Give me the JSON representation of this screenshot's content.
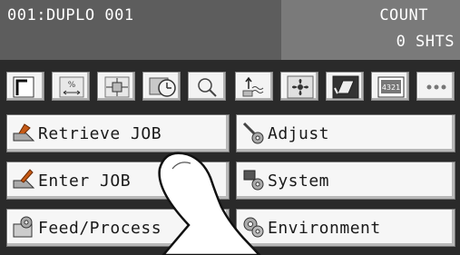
{
  "header": {
    "job_name": "001:DUPLO 001",
    "count_label": "COUNT",
    "count_value": "0 SHTS"
  },
  "toolbar": {
    "icons": [
      "paper-corner-icon",
      "percent-scale-icon",
      "position-adjust-icon",
      "timer-icon",
      "search-icon",
      "feed-wave-icon",
      "fan-icon",
      "fold-icon",
      "counter-icon",
      "more-icon"
    ],
    "counter_text": "4321",
    "more_text": "•••"
  },
  "menu": {
    "retrieve_job": "Retrieve JOB",
    "adjust": "Adjust",
    "enter_job": "Enter JOB",
    "system": "System",
    "feed_process": "Feed/Process",
    "environment": "Environment"
  },
  "colors": {
    "header_left": "#5d5d5d",
    "header_right": "#7a7a7a",
    "panel_bg": "#2a2a2a",
    "button_face": "#f6f6f6"
  }
}
